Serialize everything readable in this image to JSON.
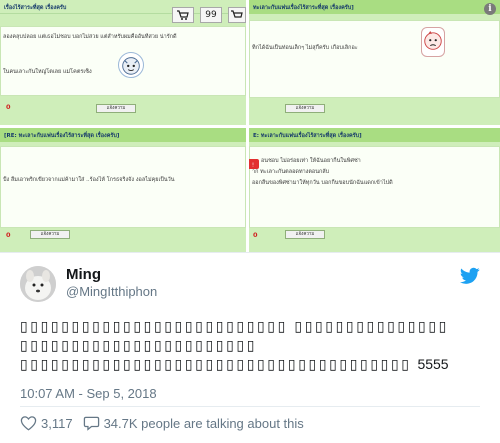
{
  "collage": {
    "panel1": {
      "title": "เรื่องไร้สาระที่สุด เรื่องครับ",
      "line1": "ลองคลุบปลอย แต่เธอไม่ชอบ บอกไม่สวย แต่สำหรับผมคืออันที่สวย น่ารักดี",
      "line2": "ในคนเลาะกันใหญ่โตเลย แม่โคตรเซ็ง",
      "count": "0",
      "reply": "แจ้งความ",
      "quote_btn": "99"
    },
    "panel2": {
      "title": "ทะเลาะกับแฟนเรื่องไร้สาระที่สุด เรื่องครับ]",
      "line1": "ท็กได้ฉันเป็นท่อนเล็กๆ ไม่สุกี้ครับ เกือบเลิกอะ",
      "reply": "แจ้งความ",
      "info": "i"
    },
    "panel3": {
      "title": "[RE: ทะเลาะกับแฟนเรื่องไร้สาระที่สุด เรื่องครับ]",
      "line1": "ปั้ง ลืมเอาพริกเขียวจากแม่ค้ามาใส่ ..ร้องไห้ โกรธจริงจัง งอลไม่คุยเป็นวัน",
      "count": "0",
      "reply": "แจ้งความ"
    },
    "panel4": {
      "title": "E: ทะเลาะกับแฟนเรื่องไร้สาระที่สุด เรื่องครับ]",
      "line1": "อนชอบ ไม่อร่อยเท่า ให้ฉันอยากิ้นในพิศซ่า",
      "line2": "าก ทะเลาะกันตลอดทางตอนกลับ",
      "line3": "ออกลืนของพิศซ่ามาให้ทุกวัน บอกกิ้นขอบนักฉันแดกเข้าไปดิ",
      "count": "0",
      "reply": "แจ้งความ"
    }
  },
  "tweet": {
    "display_name": "Ming",
    "handle": "@MingItthiphon",
    "text_line1": "▯▯▯▯▯▯▯▯▯▯▯▯▯▯▯▯▯▯▯▯▯▯▯▯▯▯ ▯▯▯▯▯▯▯▯▯▯▯▯▯▯▯",
    "text_line2": "▯▯▯▯▯▯▯▯▯▯▯▯▯▯▯▯▯▯▯▯▯▯▯",
    "text_line3": "▯▯▯▯▯▯▯▯▯▯▯▯▯▯▯▯▯▯▯▯▯▯▯▯▯▯▯▯▯▯▯▯▯▯▯▯▯▯",
    "text_suffix": "5555",
    "timestamp": "10:07 AM - Sep 5, 2018",
    "likes": "3,117",
    "talking": "34.7K people are talking about this"
  },
  "colors": {
    "panel_bg": "#cfeeba",
    "header_bg": "#a9dd82",
    "accent_red": "#d02020",
    "twitter_blue": "#1da1f2",
    "muted": "#657786"
  }
}
